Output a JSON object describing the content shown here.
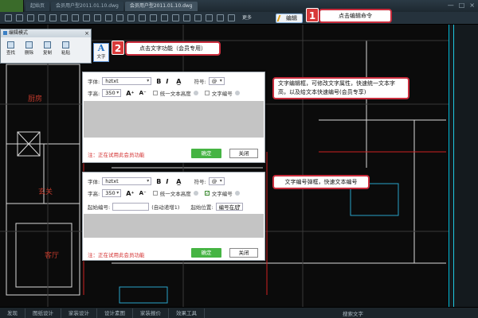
{
  "tabs": [
    {
      "label": "起始页"
    },
    {
      "label": "会员用户型2011.01.10.dwg"
    },
    {
      "label": "会员用户型2011.01.10.dwg"
    }
  ],
  "toolbar": {
    "more_label": "更多",
    "edit_label": "编辑"
  },
  "edit_panel": {
    "title": "编辑模式",
    "tools": [
      {
        "label": "查找",
        "icon": "search-icon"
      },
      {
        "label": "删除",
        "icon": "delete-icon"
      },
      {
        "label": "复制",
        "icon": "copy-icon"
      },
      {
        "label": "粘贴",
        "icon": "paste-icon"
      }
    ]
  },
  "text_tool": {
    "glyph": "A",
    "label": "文字"
  },
  "steps": [
    {
      "number": "1",
      "text": "点击编辑命令"
    },
    {
      "number": "2",
      "text": "点击文字功能（会员专用）"
    }
  ],
  "notes": {
    "edit_box": "文字编辑框，可修改文字属性，快速统一文本字高，以及给文本快速编号(会员专享)",
    "numbering_box": "文字编号弹框，快速文本编号"
  },
  "dialog_common": {
    "font_label": "字体:",
    "font_value": "hztxt",
    "bold": "B",
    "italic": "I",
    "symbol_label": "符号:",
    "symbol_value": "@",
    "height_label": "字高:",
    "height_value": "350",
    "unify_label": "统一文本高度",
    "numbering_label": "文字编号",
    "trial_note": "注：正在试用此会员功能",
    "ok_label": "确定",
    "close_label": "关闭"
  },
  "dialog2": {
    "start_no_label": "起始编号:",
    "auto_hint": "(自动递增1)",
    "position_label": "起始位置:",
    "position_value": "编号在后"
  },
  "room_labels": {
    "kitchen": "厨房",
    "entry": "玄关",
    "living": "客厅"
  },
  "bottom_tabs": [
    "发现",
    "图纸设计",
    "家装设计",
    "设计素图",
    "家装报价",
    "效果工具"
  ],
  "search_label": "搜索文字",
  "colors": {
    "accent_red": "#c92d3d",
    "ok_green": "#46b443",
    "cyan": "#1fc7e0"
  }
}
